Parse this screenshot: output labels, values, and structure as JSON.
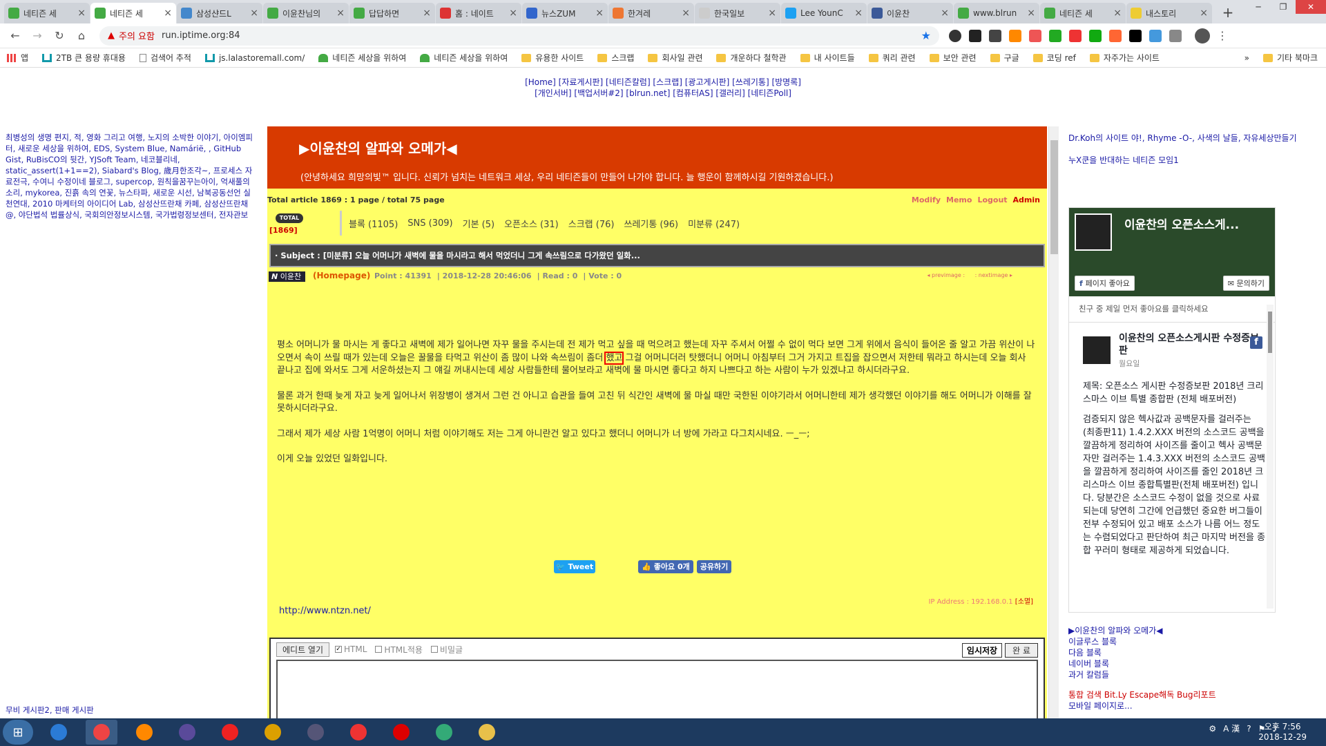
{
  "browser": {
    "tabs": [
      {
        "label": "네티즌 세",
        "icon": "sprout-icon",
        "color": "#4a4"
      },
      {
        "label": "네티즌 세",
        "icon": "sprout-icon",
        "color": "#4a4",
        "active": true
      },
      {
        "label": "삼성샨드L",
        "icon": "globe-icon",
        "color": "#48c"
      },
      {
        "label": "이윤찬님의",
        "icon": "sprout-icon",
        "color": "#4a4"
      },
      {
        "label": "답답하면",
        "icon": "sprout-icon",
        "color": "#4a4"
      },
      {
        "label": "홈 : 네이트",
        "icon": "nate-icon",
        "color": "#d33"
      },
      {
        "label": "뉴스ZUM",
        "icon": "zum-icon",
        "color": "#36c"
      },
      {
        "label": "한겨레",
        "icon": "hani-icon",
        "color": "#e73"
      },
      {
        "label": "한국일보",
        "icon": "hankook-icon",
        "color": "#ccc"
      },
      {
        "label": "Lee YounC",
        "icon": "twitter-icon",
        "color": "#1da1f2"
      },
      {
        "label": "이윤찬",
        "icon": "facebook-icon",
        "color": "#3b5998"
      },
      {
        "label": "www.blrun",
        "icon": "sprout-icon",
        "color": "#4a4"
      },
      {
        "label": "네티즌 세",
        "icon": "sprout-icon",
        "color": "#4a4"
      },
      {
        "label": "내스토리",
        "icon": "bookmark-icon",
        "color": "#ec3"
      }
    ],
    "address": {
      "warning": "주의 요함",
      "url": "run.iptime.org:84"
    },
    "bookmarks": [
      {
        "label": "앱",
        "type": "apps"
      },
      {
        "label": "2TB 큰 용량 휴대용",
        "type": "u"
      },
      {
        "label": "검색어 추적",
        "type": "page"
      },
      {
        "label": "js.lalastoremall.com/",
        "type": "u"
      },
      {
        "label": "네티즌 세상을 위하여",
        "type": "sprout"
      },
      {
        "label": "네티즌 세상을 위하여",
        "type": "sprout"
      },
      {
        "label": "유용한 사이트",
        "type": "folder"
      },
      {
        "label": "스크랩",
        "type": "folder"
      },
      {
        "label": "회사일 관련",
        "type": "folder"
      },
      {
        "label": "개운하다 철학관",
        "type": "folder"
      },
      {
        "label": "내 사이트들",
        "type": "folder"
      },
      {
        "label": "쿼리 관련",
        "type": "folder"
      },
      {
        "label": "보안 관련",
        "type": "folder"
      },
      {
        "label": "구글",
        "type": "folder"
      },
      {
        "label": "코딩 ref",
        "type": "folder"
      },
      {
        "label": "자주가는 사이트",
        "type": "folder"
      }
    ],
    "bookmarks_more": "»",
    "bookmarks_other": "기타 북마크"
  },
  "topnav": {
    "line1": "[Home] [자료게시판] [네티즌칼럼] [스크랩] [광고게시판] [쓰레기통] [방명록]",
    "line2": "[개인서버] [백업서버#2] [blrun.net] [컴퓨터AS] [갤러리] [네티즌Poll]"
  },
  "leftcol": {
    "links": "최병성의 생명 편지, 적, 영화 그리고 여행, 노지의 소박한 이야기, 아이엠피터, 새로운 세상을 위하여, EDS, System Blue, Namárië, , GitHub Gist, RuBisCO의 뒷간, YJSoft Team, 네코블리네, static_assert(1+1==2), Siabard's Blog, 歲月한조각~, 프로세스 자료전극, 수여니 수정이네 블로그, supercop, 원칙을꿈꾸는아이, 억새풀의 소리, mykorea, 진흙 속의 연꽃, 뉴스타파, 새로운 시선, 남북공동선언 실천연대, 2010 마케터의 아이디어 Lab, 삼성산뜨란채 카페, 삼성산뜨란채@, 야단법석 법률상식, 국회의안정보시스템, 국가법령정보센터, 전자관보",
    "footer": "무비 게시판2, 판매 게시판"
  },
  "board": {
    "title": "▶이윤찬의 알파와 오메가◀",
    "subtitle": "(안녕하세요 희망의빛™ 입니다. 신뢰가 넘치는 네트워크 세상, 우리 네티즌들이 만들어 나가야 합니다. 늘 행운이 함께하시길 기원하겠습니다.)",
    "stats": "Total article 1869 :    1 page / total 75 page",
    "admin_links": [
      "Modify",
      "Memo",
      "Logout",
      "Admin"
    ],
    "total_badge": "TOTAL",
    "total_count": "[1869]",
    "categories": [
      "블록 (1105)",
      "SNS (309)",
      "기본 (5)",
      "오픈소스 (31)",
      "스크랩 (76)",
      "쓰레기통 (96)",
      "미분류 (247)"
    ],
    "subject": "· Subject : [미분류] 오늘 어머니가 새벽에 물을 마시라고 해서 먹었더니 그게 속쓰림으로 다가왔던 일화...",
    "author": "이윤찬",
    "author_prefix": "N",
    "homepage": "(Homepage)",
    "point": "Point : 41391",
    "date": "2018-12-28 20:46:06",
    "read": "Read : 0",
    "vote": "Vote : 0",
    "prev": "◂ previmage :",
    "next": ": nextimage ▸",
    "body_p1_a": "평소 어머니가 물 마시는 게 좋다고 새벽에 제가 일어나면 자꾸 물을 주시는데 전 제가 먹고 싶을 때 먹으려고 했는데 자꾸 주셔서 어쩔 수 없이 먹다 보면 그게 위에서 음식이 들어온 줄 알고 가끔 위산이 나오면서 속이 쓰릴 때가 있는데 오늘은 꿀물을 타먹고 위산이 좀 많이 나와 속쓰림이 좀더 ",
    "body_p1_hl": "했고",
    "body_p1_b": " 그걸 어머니더러 탓했더니 어머니 아침부터 그거 가지고 트집을 잡으면서 저한테 뭐라고 하시는데 오늘 회사 끝나고 집에 와서도 그게 서운하셨는지 그 얘길 꺼내시는데 세상 사람들한테 물어보라고 새벽에 물 마시면 좋다고 하지 나쁘다고 하는 사람이 누가 있겠냐고 하시더라구요.",
    "body_p2": "물론 과거 한때 늦게 자고 늦게 일어나서 위장병이 생겨서 그런 건 아니고 습관을 들여 고친 뒤 식간인 새벽에 물 마실 때만 국한된 이야기라서 어머니한테 제가 생각했던 이야기를 해도 어머니가 이해를 잘 못하시더라구요.",
    "body_p3": "그래서 제가 세상 사람 1억명이 어머니 처럼 이야기해도 저는 그게 아니란건 알고 있다고 했더니 어머니가 너 방에 가라고 다그치시네요. ㅡ_ㅡ;",
    "body_p4": "이게 오늘 있었던 일화입니다.",
    "tweet_label": "Tweet",
    "fb_like_label": "좋아요 0개",
    "fb_share_label": "공유하기",
    "ip_address": "IP Address : 192.168.0.1",
    "delete_label": "[소멸]",
    "post_link": "http://www.ntzn.net/"
  },
  "editor": {
    "open_label": "에디트 열기",
    "html_label": "HTML",
    "html_apply_label": "HTML적용",
    "secret_label": "비밀글",
    "html_checked": true,
    "temp_save_label": "임시저장",
    "done_label": "완 료"
  },
  "rightcol": {
    "links1": "Dr.Koh의 사이트 야!, Rhyme -O-, 사색의 날들, 자유세상만들기",
    "links2": "누X쿤을 반대하는 네티즌 모임1",
    "fb": {
      "page_name": "이윤찬의 오픈소스게...",
      "like_page": "페이지 좋아요",
      "message": "문의하기",
      "friend_text": "친구 중 제일 먼저 좋아요를 클릭하세요",
      "post_name": "이윤찬의 오픈소스게시판 수정증보판",
      "post_date": "월요일",
      "post_text1": "제목: 오픈소스 게시판 수정증보판 2018년 크리스마스 이브 특별 종합판 (전체 배포버전)",
      "post_text2": "검증되지 않은 헥사값과 공백문자를 걸러주는 (최종판11) 1.4.2.XXX 버전의 소스코드 공백을 깔끔하게 정리하여 사이즈를 줄이고 헥사 공백문자만 걸러주는 1.4.3.XXX 버전의 소스코드 공백을 깔끔하게 정리하여 사이즈를 줄인 2018년 크리스마스 이브 종합특별판(전체 배포버전) 입니다. 당분간은 소스코드 수정이 없을 것으로 사료되는데 당연히 그간에 언급했던 중요한 버그들이 전부 수정되어 있고 배포 소스가 나름 어느 정도는 수렴되었다고 판단하여 최근 마지막 버전을 종합 꾸러미 형태로 제공하게 되었습니다."
    },
    "bottom_links": [
      "▶이윤찬의 알파와 오메가◀",
      "이글루스 블록",
      "다음 블록",
      "네이버 블록",
      "과거 칼럼들"
    ],
    "bottom2": "통합 검색 Bit.Ly Escape해독 Bug리포트",
    "bottom3": "모바일 페이지로..."
  },
  "taskbar": {
    "apps": [
      {
        "name": "ie-icon",
        "color": "#2b7bd6"
      },
      {
        "name": "chrome-icon",
        "color": "#e44",
        "active": true
      },
      {
        "name": "firefox-icon",
        "color": "#f80"
      },
      {
        "name": "eclipse-icon",
        "color": "#5a4a9a"
      },
      {
        "name": "opera-icon",
        "color": "#e22"
      },
      {
        "name": "pencil-icon",
        "color": "#dca000"
      },
      {
        "name": "book-icon",
        "color": "#557"
      },
      {
        "name": "pokeball-icon",
        "color": "#e33"
      },
      {
        "name": "record-icon",
        "color": "#d00"
      },
      {
        "name": "tree-icon",
        "color": "#3a7"
      },
      {
        "name": "folder-icon",
        "color": "#e8c04a"
      }
    ],
    "ime": "A 漢",
    "time": "오후 7:56",
    "date": "2018-12-29"
  }
}
